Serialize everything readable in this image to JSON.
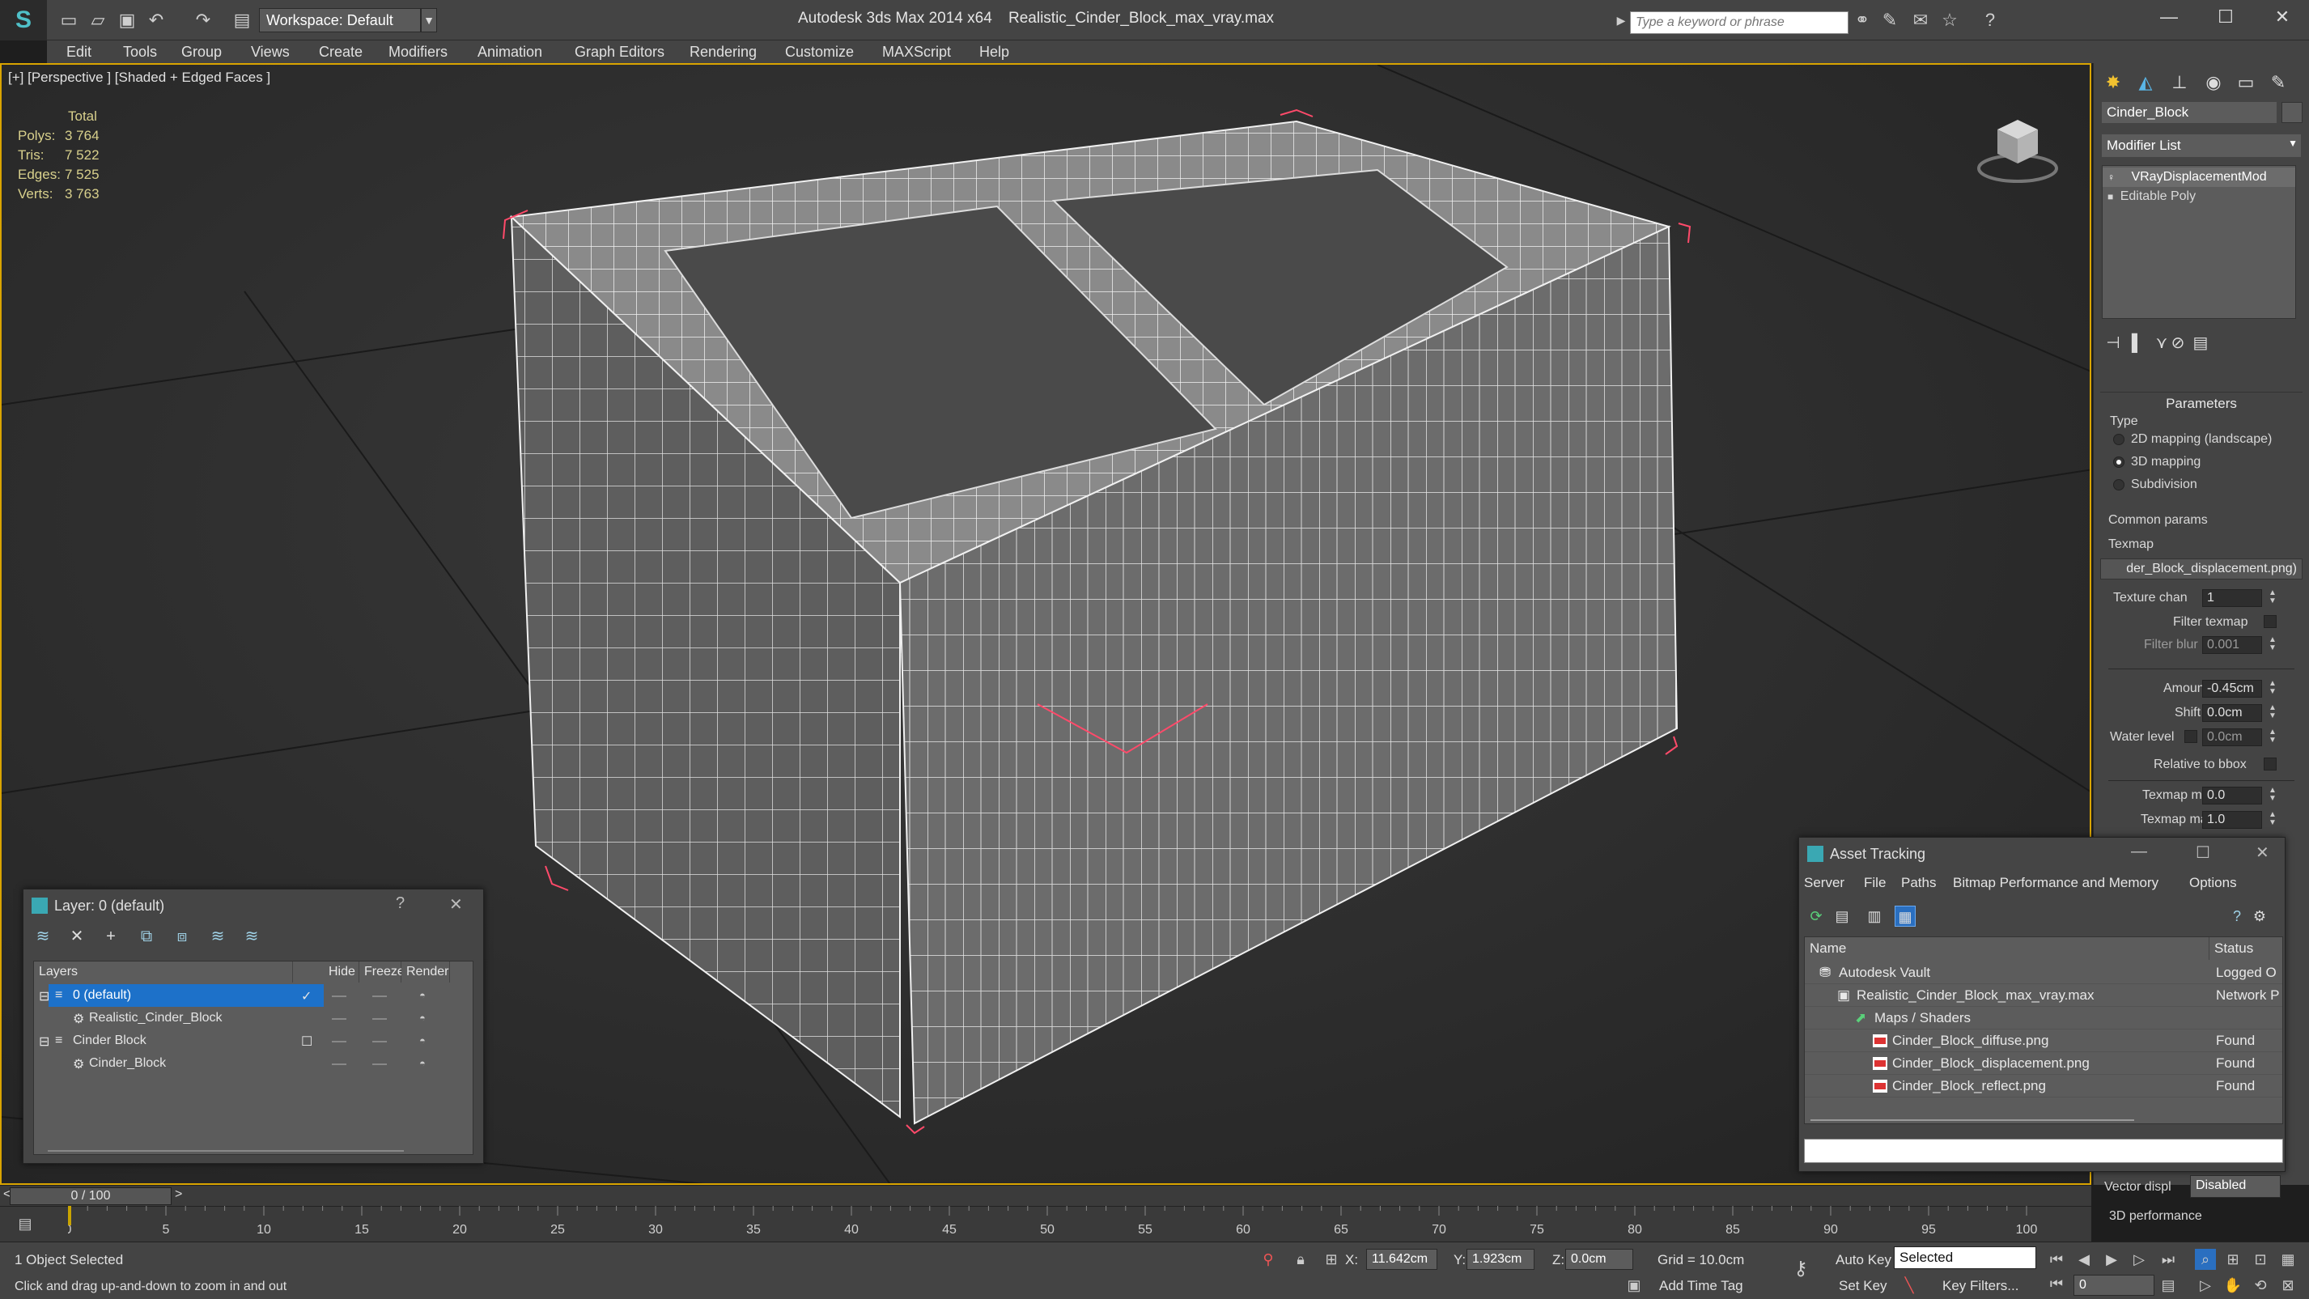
{
  "titlebar": {
    "app_title": "Autodesk 3ds Max  2014 x64",
    "doc_title": "Realistic_Cinder_Block_max_vray.max",
    "workspace": "Workspace: Default",
    "search_placeholder": "Type a keyword or phrase",
    "logo_letter": "S"
  },
  "menu": [
    "Edit",
    "Tools",
    "Group",
    "Views",
    "Create",
    "Modifiers",
    "Animation",
    "Graph Editors",
    "Rendering",
    "Customize",
    "MAXScript",
    "Help"
  ],
  "viewport": {
    "label": "[+] [Perspective ] [Shaded + Edged Faces ]",
    "stats": {
      "header": "Total",
      "rows": [
        {
          "label": "Polys:",
          "value": "3 764"
        },
        {
          "label": "Tris:",
          "value": "7 522"
        },
        {
          "label": "Edges:",
          "value": "7 525"
        },
        {
          "label": "Verts:",
          "value": "3 763"
        }
      ]
    },
    "border_color": "#d9a400"
  },
  "command_panel": {
    "object_name": "Cinder_Block",
    "modifier_list": "Modifier List",
    "stack": [
      "VRayDisplacementMod",
      "Editable Poly"
    ],
    "params_title": "Parameters",
    "type_label": "Type",
    "types": [
      {
        "label": "2D mapping (landscape)",
        "selected": false
      },
      {
        "label": "3D mapping",
        "selected": true
      },
      {
        "label": "Subdivision",
        "selected": false
      }
    ],
    "common_params": "Common params",
    "texmap_label": "Texmap",
    "texmap_value": "der_Block_displacement.png)",
    "texture_chan_label": "Texture chan",
    "texture_chan_value": "1",
    "filter_texmap_label": "Filter texmap",
    "filter_blur_label": "Filter blur",
    "filter_blur_value": "0.001",
    "amount_label": "Amount",
    "amount_value": "-0.45cm",
    "shift_label": "Shift",
    "shift_value": "0.0cm",
    "water_level_label": "Water level",
    "water_level_value": "0.0cm",
    "relative_bbox_label": "Relative to bbox",
    "texmap_min_label": "Texmap min",
    "texmap_min_value": "0.0",
    "texmap_max_label": "Texmap max",
    "texmap_max_value": "1.0",
    "vector_disp_label": "Vector displ",
    "vector_disp_value": "Disabled",
    "perf_3d_label": "3D performance"
  },
  "layer_dialog": {
    "title": "Layer: 0 (default)",
    "help": "?",
    "close": "✕",
    "columns": [
      "Layers",
      "Hide",
      "Freeze",
      "Render"
    ],
    "rows": [
      {
        "name": "0 (default)",
        "indent": 1,
        "kind": "layer",
        "selected": true,
        "checked": true
      },
      {
        "name": "Realistic_Cinder_Block",
        "indent": 2,
        "kind": "object",
        "selected": false,
        "checked": false
      },
      {
        "name": "Cinder Block",
        "indent": 1,
        "kind": "layer",
        "selected": false,
        "checked": false
      },
      {
        "name": "Cinder_Block",
        "indent": 2,
        "kind": "object",
        "selected": false,
        "checked": false
      }
    ]
  },
  "asset_dialog": {
    "title": "Asset Tracking",
    "menu": [
      "Server",
      "File",
      "Paths",
      "Bitmap Performance and Memory",
      "Options"
    ],
    "columns": [
      "Name",
      "Status"
    ],
    "rows": [
      {
        "name": "Autodesk Vault",
        "indent": 1,
        "status": "Logged O"
      },
      {
        "name": "Realistic_Cinder_Block_max_vray.max",
        "indent": 2,
        "status": "Network P"
      },
      {
        "name": "Maps / Shaders",
        "indent": 3,
        "status": ""
      },
      {
        "name": "Cinder_Block_diffuse.png",
        "indent": 4,
        "status": "Found"
      },
      {
        "name": "Cinder_Block_displacement.png",
        "indent": 4,
        "status": "Found"
      },
      {
        "name": "Cinder_Block_reflect.png",
        "indent": 4,
        "status": "Found"
      }
    ]
  },
  "timeline": {
    "frame": "0 / 100",
    "prev": "<",
    "next": ">",
    "ticks": [
      "0",
      "5",
      "10",
      "15",
      "20",
      "25",
      "30",
      "35",
      "40",
      "45",
      "50",
      "55",
      "60",
      "65",
      "70",
      "75",
      "80",
      "85",
      "90",
      "95",
      "100"
    ]
  },
  "status": {
    "selection": "1 Object Selected",
    "prompt": "Click and drag up-and-down to zoom in and out",
    "x_label": "X:",
    "x_value": "11.642cm",
    "y_label": "Y:",
    "y_value": "1.923cm",
    "z_label": "Z:",
    "z_value": "0.0cm",
    "grid": "Grid = 10.0cm",
    "add_time_tag": "Add Time Tag",
    "auto_key": "Auto Key",
    "set_key": "Set Key",
    "selected_mode": "Selected",
    "key_filters": "Key Filters...",
    "current_frame": "0"
  }
}
